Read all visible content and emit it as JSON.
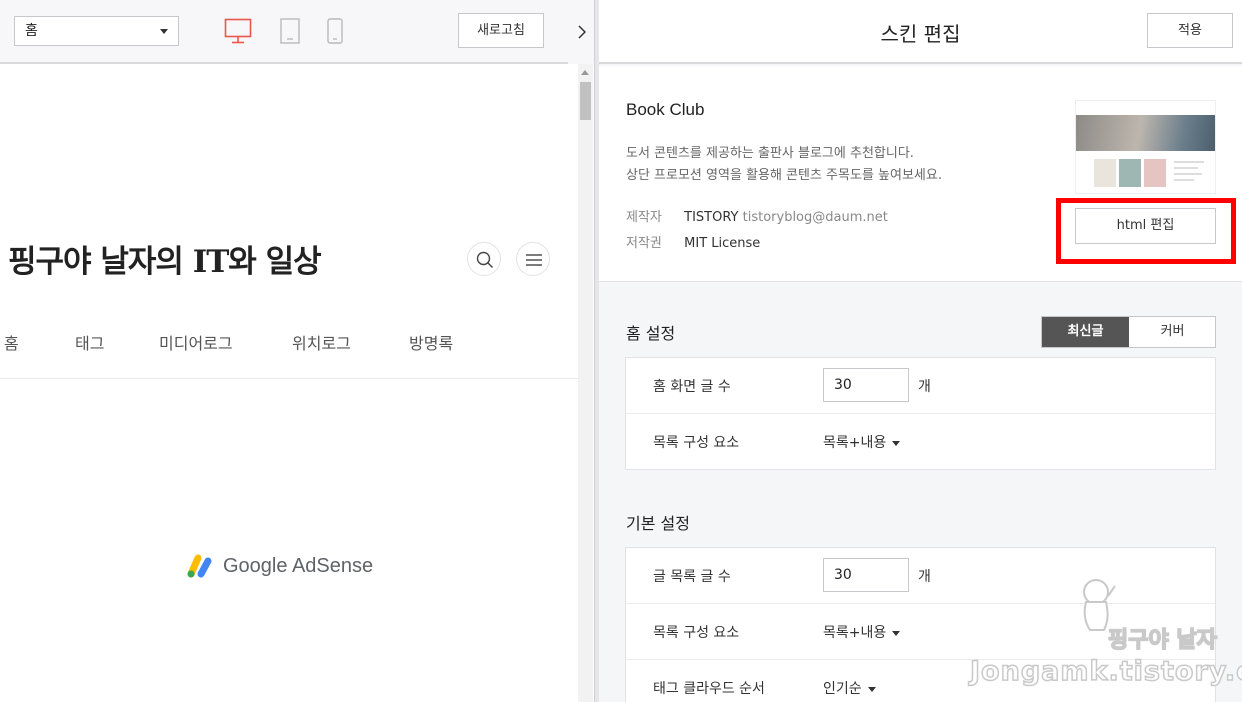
{
  "toolbar": {
    "page_select": "홈",
    "devices": [
      "desktop-icon",
      "tablet-icon",
      "mobile-icon"
    ],
    "refresh_label": "새로고침",
    "active_device_color": "#e8574a"
  },
  "preview": {
    "blog_title": "핑구야 날자의 IT와 일상",
    "nav": [
      "홈",
      "태그",
      "미디어로그",
      "위치로그",
      "방명록"
    ],
    "adsense_text": "Google AdSense"
  },
  "panel": {
    "title": "스킨 편집",
    "apply_label": "적용",
    "collapse_icon": "chevron-right-icon"
  },
  "skin": {
    "name": "Book Club",
    "desc_line1": "도서 콘텐츠를 제공하는 출판사 블로그에 추천합니다.",
    "desc_line2": "상단 프로모션 영역을 활용해 콘텐츠 주목도를 높여보세요.",
    "author_key": "제작자",
    "author_name": "TISTORY",
    "author_email": "tistoryblog@daum.net",
    "license_key": "저작권",
    "license_value": "MIT License",
    "html_edit_label": "html 편집",
    "highlight_color": "#ff0000"
  },
  "home_settings": {
    "title": "홈 설정",
    "toggle": [
      "최신글",
      "커버"
    ],
    "rows": [
      {
        "label": "홈 화면 글 수",
        "value": "30",
        "unit": "개"
      },
      {
        "label": "목록 구성 요소",
        "value": "목록+내용"
      }
    ]
  },
  "basic_settings": {
    "title": "기본 설정",
    "rows": [
      {
        "label": "글 목록 글 수",
        "value": "30",
        "unit": "개"
      },
      {
        "label": "목록 구성 요소",
        "value": "목록+내용"
      },
      {
        "label": "태그 클라우드 순서",
        "value": "인기순"
      }
    ]
  },
  "watermark": {
    "line1": "핑구야 날자",
    "line2": "Jongamk.tistory.com"
  }
}
